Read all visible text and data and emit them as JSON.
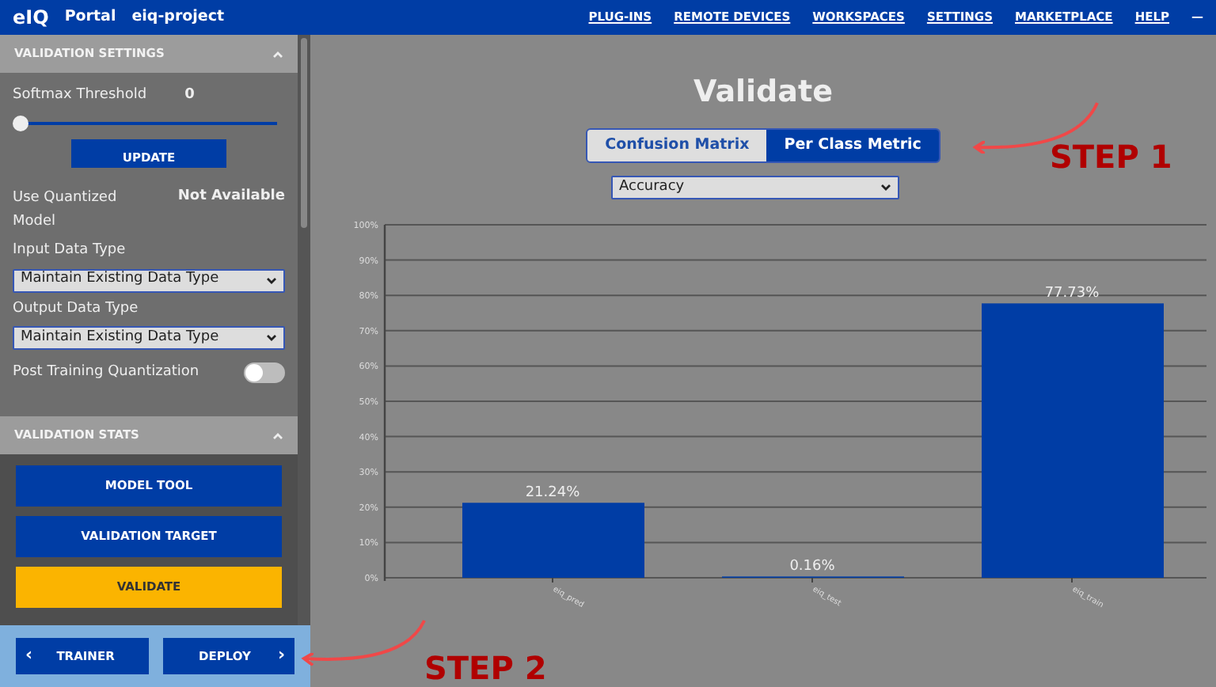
{
  "navbar": {
    "logo": "eIQ",
    "app": "Portal",
    "project": "eiq-project",
    "menu": [
      "PLUG-INS",
      "REMOTE DEVICES",
      "WORKSPACES",
      "SETTINGS",
      "MARKETPLACE",
      "HELP"
    ],
    "window_control": "—"
  },
  "sidebar": {
    "sections": [
      {
        "title": "VALIDATION SETTINGS",
        "expanded": true
      },
      {
        "title": "VALIDATION STATS",
        "expanded": true
      }
    ],
    "softmax": {
      "label": "Softmax Threshold",
      "value": "0",
      "level": 0
    },
    "update_button": "UPDATE",
    "quantized": {
      "label": "Use Quantized Model",
      "value": "Not Available"
    },
    "input_type": {
      "label": "Input Data Type",
      "value": "Maintain Existing Data Type"
    },
    "output_type": {
      "label": "Output Data Type",
      "value": "Maintain Existing Data Type"
    },
    "ptq": {
      "label": "Post Training Quantization",
      "on": false
    },
    "actions": [
      {
        "label": "MODEL TOOL",
        "kind": "primary"
      },
      {
        "label": "VALIDATION TARGET",
        "kind": "primary"
      },
      {
        "label": "VALIDATE",
        "kind": "highlight"
      }
    ],
    "nav": [
      {
        "label": "TRAINER",
        "arrow": "‹"
      },
      {
        "label": "DEPLOY",
        "arrow": "›"
      }
    ]
  },
  "main": {
    "title": "Validate",
    "tabs": [
      {
        "label": "Confusion Matrix",
        "selected": false
      },
      {
        "label": "Per Class Metric",
        "selected": true
      }
    ],
    "metric": {
      "value": "Accuracy"
    },
    "chart_data": {
      "type": "bar",
      "categories": [
        "eiq_pred",
        "eiq_test",
        "eiq_train"
      ],
      "series": [
        {
          "color": "#003da5",
          "values": [
            0.2124,
            0.0016,
            0.7773
          ]
        }
      ],
      "ylim": [
        0,
        1
      ],
      "grid": true,
      "yticks": [
        {
          "value": 0,
          "label": "0%"
        },
        {
          "value": 0.1,
          "label": "10%"
        },
        {
          "value": 0.2,
          "label": "20%"
        },
        {
          "value": 0.3,
          "label": "30%"
        },
        {
          "value": 0.4,
          "label": "40%"
        },
        {
          "value": 0.5,
          "label": "50%"
        },
        {
          "value": 0.6,
          "label": "60%"
        },
        {
          "value": 0.7,
          "label": "70%"
        },
        {
          "value": 0.8,
          "label": "80%"
        },
        {
          "value": 0.9,
          "label": "90%"
        },
        {
          "value": 1,
          "label": "100%"
        }
      ],
      "value_labels": [
        "21.24%",
        "0.16%",
        "77.73%"
      ]
    }
  },
  "annotations": [
    "STEP 1",
    "STEP 2"
  ]
}
